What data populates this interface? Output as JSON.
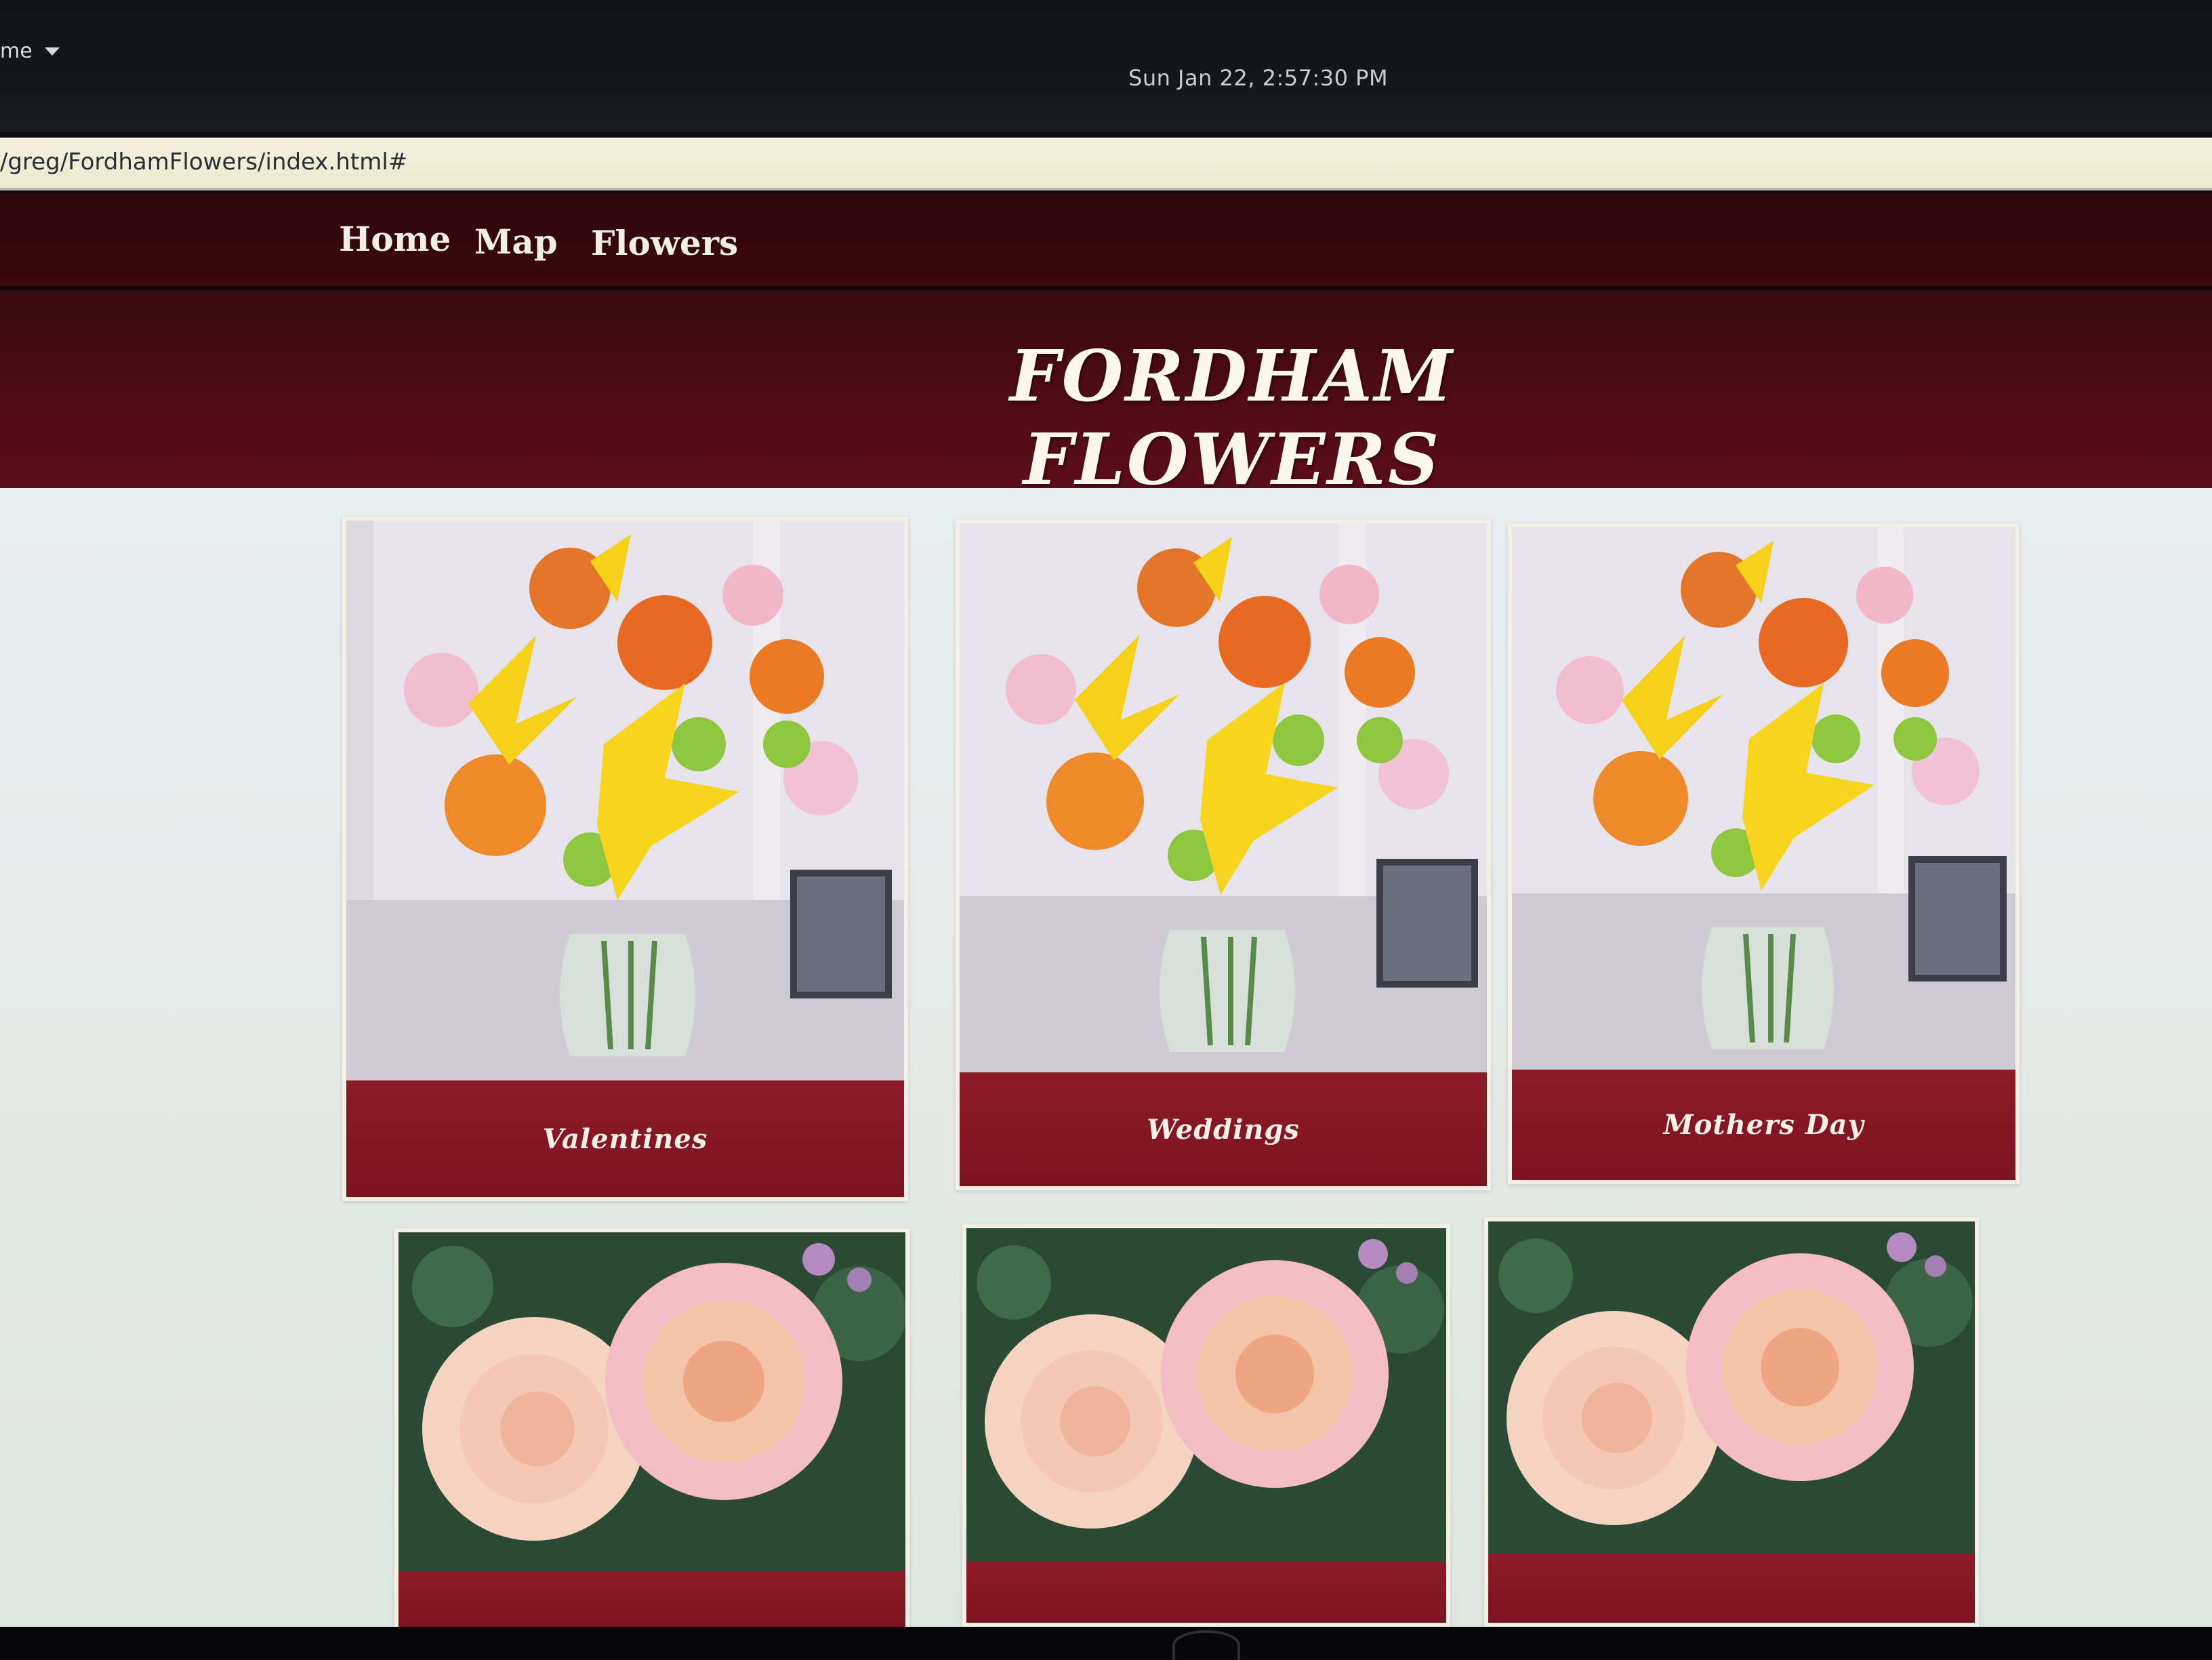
{
  "os_panel": {
    "menu_label": "me",
    "clock": "Sun Jan 22,  2:57:30 PM"
  },
  "browser": {
    "url": "/greg/FordhamFlowers/index.html#"
  },
  "nav": {
    "items": [
      "Home",
      "Map",
      "Flowers"
    ]
  },
  "site": {
    "title": "FORDHAM FLOWERS",
    "brand_color": "#5c0e18",
    "caption_color": "#8e1a26"
  },
  "cards": [
    {
      "caption": "Valentines",
      "image": "bouquet-image"
    },
    {
      "caption": "Weddings",
      "image": "bouquet-image"
    },
    {
      "caption": "Mothers Day",
      "image": "bouquet-image"
    },
    {
      "caption": "",
      "image": "roses-image"
    },
    {
      "caption": "",
      "image": "roses-image"
    },
    {
      "caption": "",
      "image": "roses-image"
    }
  ]
}
